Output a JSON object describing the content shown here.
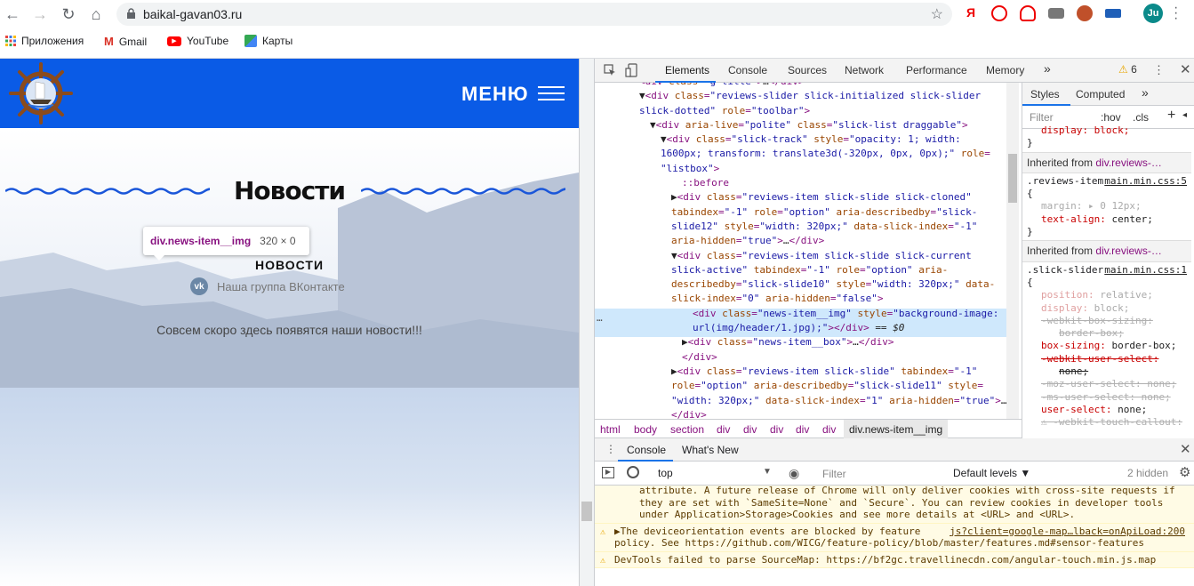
{
  "browser": {
    "url": "baikal-gavan03.ru",
    "profile_initials": "Ju",
    "bookmarks": [
      "Приложения",
      "Gmail",
      "YouTube",
      "Карты"
    ]
  },
  "site": {
    "menu_label": "МЕНЮ",
    "section_title": "Новости",
    "tooltip_tag": "div.news-item__img",
    "tooltip_size": "320 × 0",
    "subtitle": "НОВОСТИ",
    "vk_label": "Наша группа ВКонтакте",
    "vk_icon_text": "vk",
    "soon_text": "Совсем скоро здесь появятся наши новости!!!"
  },
  "devtools": {
    "tabs": [
      "Elements",
      "Console",
      "Sources",
      "Network",
      "Performance",
      "Memory"
    ],
    "more": "»",
    "warnings_count": "6",
    "breadcrumbs": [
      "html",
      "body",
      "section",
      "div",
      "div",
      "div",
      "div",
      "div",
      "div.news-item__img"
    ],
    "styles_tabs": [
      "Styles",
      "Computed"
    ],
    "filter_placeholder": "Filter",
    "hov": ":hov",
    "cls": ".cls",
    "inherited1": "Inherited from",
    "inherited1_link": "div.reviews-…",
    "rule1_selector": ".reviews-item {",
    "rule1_src": "main.min.css:5",
    "inherited2_link": "div.reviews-…",
    "rule2_selector": ".slick-slider {",
    "rule2_src": "main.min.css:1",
    "top_display": "display: block;",
    "console_tabs": [
      "Console",
      "What's New"
    ],
    "context": "top",
    "con_filter": "Filter",
    "levels": "Default levels ▼",
    "hidden": "2 hidden",
    "messages": [
      "attribute. A future release of Chrome will only deliver cookies with cross-site requests if they are set with `SameSite=None` and `Secure`. You can review cookies in developer tools under Application>Storage>Cookies and see more details at <URL> and <URL>.",
      "▶The deviceorientation events are blocked by feature policy. See https://github.com/WICG/feature-policy/blob/master/features.md#sensor-features",
      "DevTools failed to parse SourceMap: https://bf2gc.travellinecdn.com/angular-touch.min.js.map"
    ],
    "msg2_link": "js?client=google-map…lback=onApiLoad:200"
  }
}
